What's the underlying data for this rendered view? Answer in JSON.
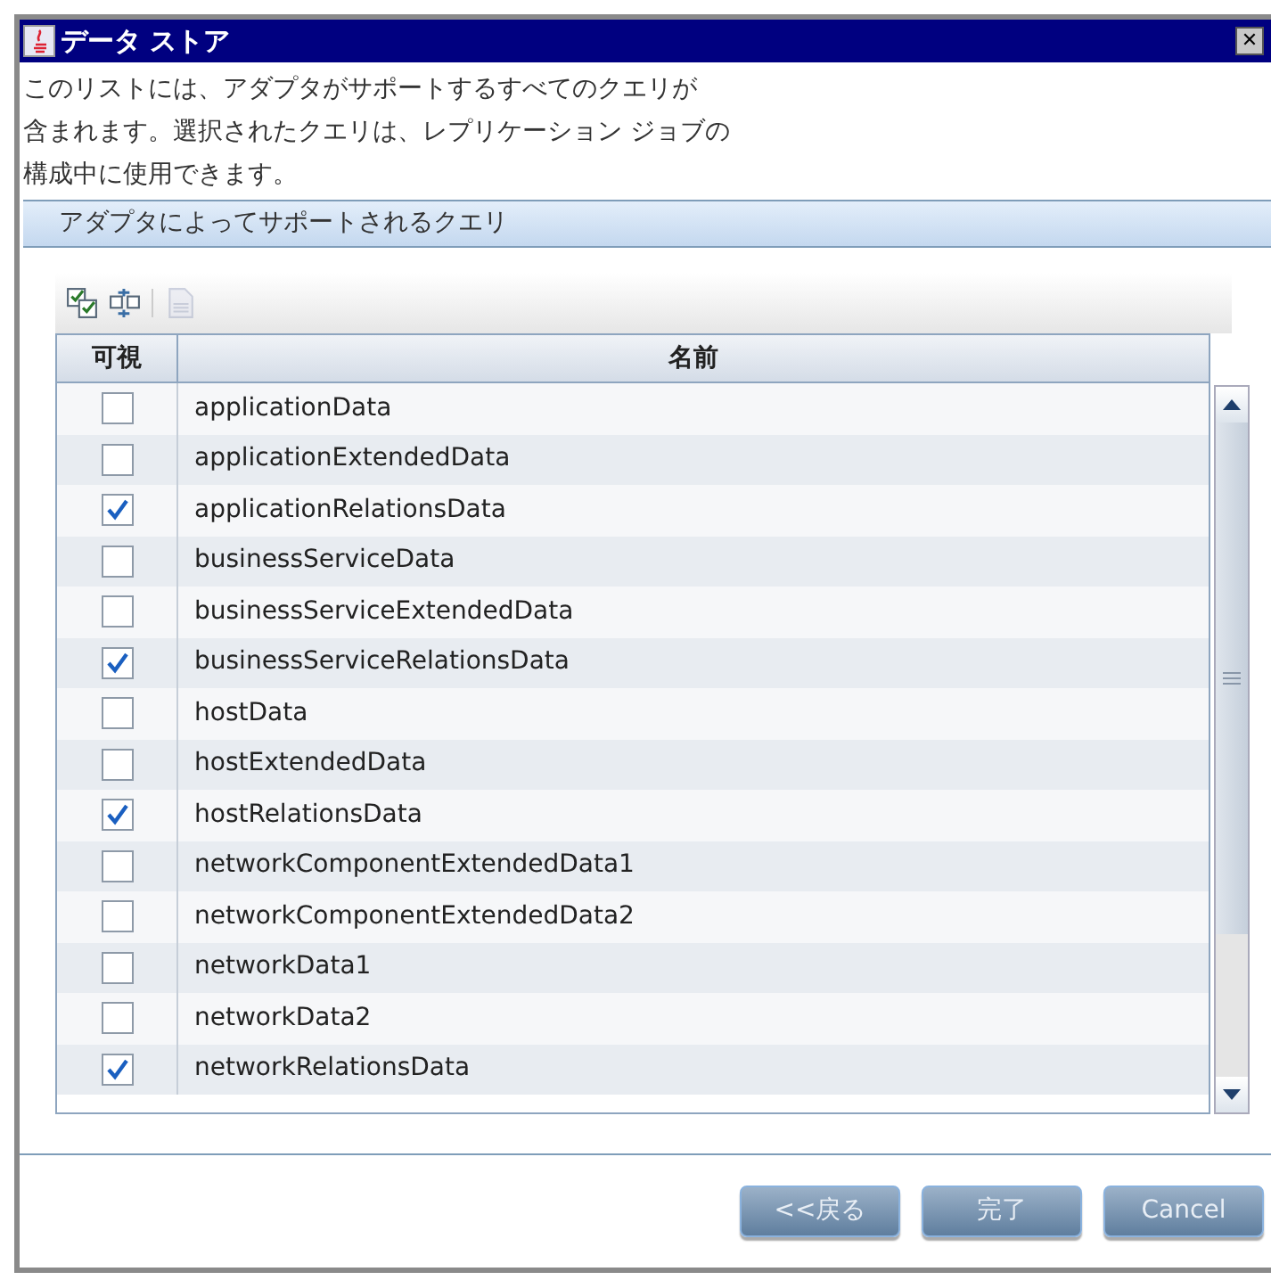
{
  "window": {
    "title": "データ ストア",
    "close": "✕"
  },
  "description": [
    "このリストには、アダプタがサポートするすべてのクエリが",
    "含まれます。選択されたクエリは、レプリケーション ジョブの",
    "構成中に使用できます。"
  ],
  "panel": {
    "title": "アダプタによってサポートされるクエリ"
  },
  "toolbar": [
    {
      "kind": "check-all",
      "disabled": false
    },
    {
      "kind": "invert",
      "disabled": false
    },
    {
      "kind": "details",
      "disabled": true
    }
  ],
  "table": {
    "columns": [
      "可視",
      "名前"
    ],
    "rows": [
      {
        "name": "applicationData",
        "checked": false
      },
      {
        "name": "applicationExtendedData",
        "checked": false
      },
      {
        "name": "applicationRelationsData",
        "checked": true
      },
      {
        "name": "businessServiceData",
        "checked": false
      },
      {
        "name": "businessServiceExtendedData",
        "checked": false
      },
      {
        "name": "businessServiceRelationsData",
        "checked": true
      },
      {
        "name": "hostData",
        "checked": false
      },
      {
        "name": "hostExtendedData",
        "checked": false
      },
      {
        "name": "hostRelationsData",
        "checked": true
      },
      {
        "name": "networkComponentExtendedData1",
        "checked": false
      },
      {
        "name": "networkComponentExtendedData2",
        "checked": false
      },
      {
        "name": "networkData1",
        "checked": false
      },
      {
        "name": "networkData2",
        "checked": false
      },
      {
        "name": "networkRelationsData",
        "checked": true
      }
    ]
  },
  "buttons": [
    "<<戻る",
    "完了",
    "Cancel"
  ]
}
